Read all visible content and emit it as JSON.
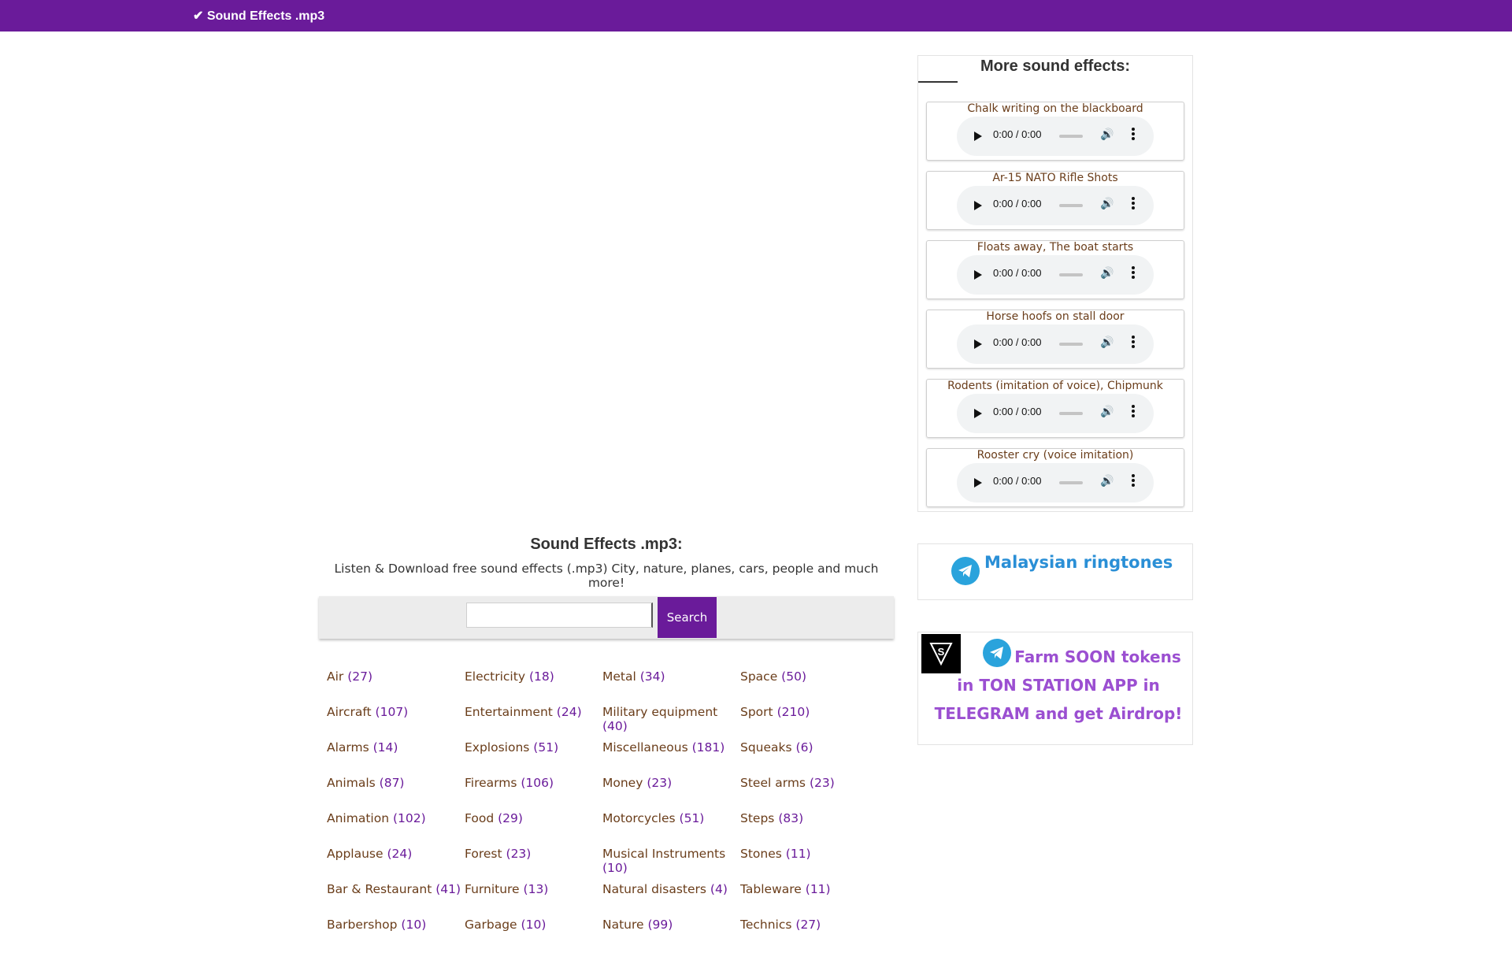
{
  "header": {
    "brand": "✔ Sound Effects .mp3",
    "bg_color": "#6a1b9a"
  },
  "main": {
    "title": "Sound Effects .mp3:",
    "subtitle": "Listen & Download free sound effects (.mp3) City, nature, planes, cars, people and much more!",
    "search": {
      "value": "",
      "placeholder": "",
      "button_label": "Search"
    },
    "categories": [
      {
        "name": "Air",
        "count": "(27)"
      },
      {
        "name": "Electricity",
        "count": "(18)"
      },
      {
        "name": "Metal",
        "count": "(34)"
      },
      {
        "name": "Space",
        "count": "(50)"
      },
      {
        "name": "Aircraft",
        "count": "(107)"
      },
      {
        "name": "Entertainment",
        "count": "(24)"
      },
      {
        "name": "Military equipment",
        "count": "(40)"
      },
      {
        "name": "Sport",
        "count": "(210)"
      },
      {
        "name": "Alarms",
        "count": "(14)"
      },
      {
        "name": "Explosions",
        "count": "(51)"
      },
      {
        "name": "Miscellaneous",
        "count": "(181)"
      },
      {
        "name": "Squeaks",
        "count": "(6)"
      },
      {
        "name": "Animals",
        "count": "(87)"
      },
      {
        "name": "Firearms",
        "count": "(106)"
      },
      {
        "name": "Money",
        "count": "(23)"
      },
      {
        "name": "Steel arms",
        "count": "(23)"
      },
      {
        "name": "Animation",
        "count": "(102)"
      },
      {
        "name": "Food",
        "count": "(29)"
      },
      {
        "name": "Motorcycles",
        "count": "(51)"
      },
      {
        "name": "Steps",
        "count": "(83)"
      },
      {
        "name": "Applause",
        "count": "(24)"
      },
      {
        "name": "Forest",
        "count": "(23)"
      },
      {
        "name": "Musical Instruments",
        "count": "(10)"
      },
      {
        "name": "Stones",
        "count": "(11)"
      },
      {
        "name": "Bar & Restaurant",
        "count": "(41)"
      },
      {
        "name": "Furniture",
        "count": "(13)"
      },
      {
        "name": "Natural disasters",
        "count": "(4)"
      },
      {
        "name": "Tableware",
        "count": "(11)"
      },
      {
        "name": "Barbershop",
        "count": "(10)"
      },
      {
        "name": "Garbage",
        "count": "(10)"
      },
      {
        "name": "Nature",
        "count": "(99)"
      },
      {
        "name": "Technics",
        "count": "(27)"
      }
    ]
  },
  "sidebar": {
    "title": "More sound effects:",
    "tracks": [
      {
        "title": "Chalk writing on the blackboard",
        "time": "0:00 / 0:00"
      },
      {
        "title": "Ar-15 NATO Rifle Shots",
        "time": "0:00 / 0:00"
      },
      {
        "title": "Floats away, The boat starts",
        "time": "0:00 / 0:00"
      },
      {
        "title": "Horse hoofs on stall door",
        "time": "0:00 / 0:00"
      },
      {
        "title": "Rodents (imitation of voice), Chipmunk",
        "time": "0:00 / 0:00"
      },
      {
        "title": "Rooster cry (voice imitation)",
        "time": "0:00 / 0:00"
      }
    ],
    "telegram_link": "Malaysian ringtones",
    "promo_text": "Farm SOON tokens in TON STATION APP in TELEGRAM and get Airdrop!",
    "promo_logo_text": "S"
  },
  "colors": {
    "accent": "#6a1b9a",
    "link_brown": "#6a3d1a",
    "telegram": "#2aa3dc",
    "promo": "#9b4fd1"
  }
}
